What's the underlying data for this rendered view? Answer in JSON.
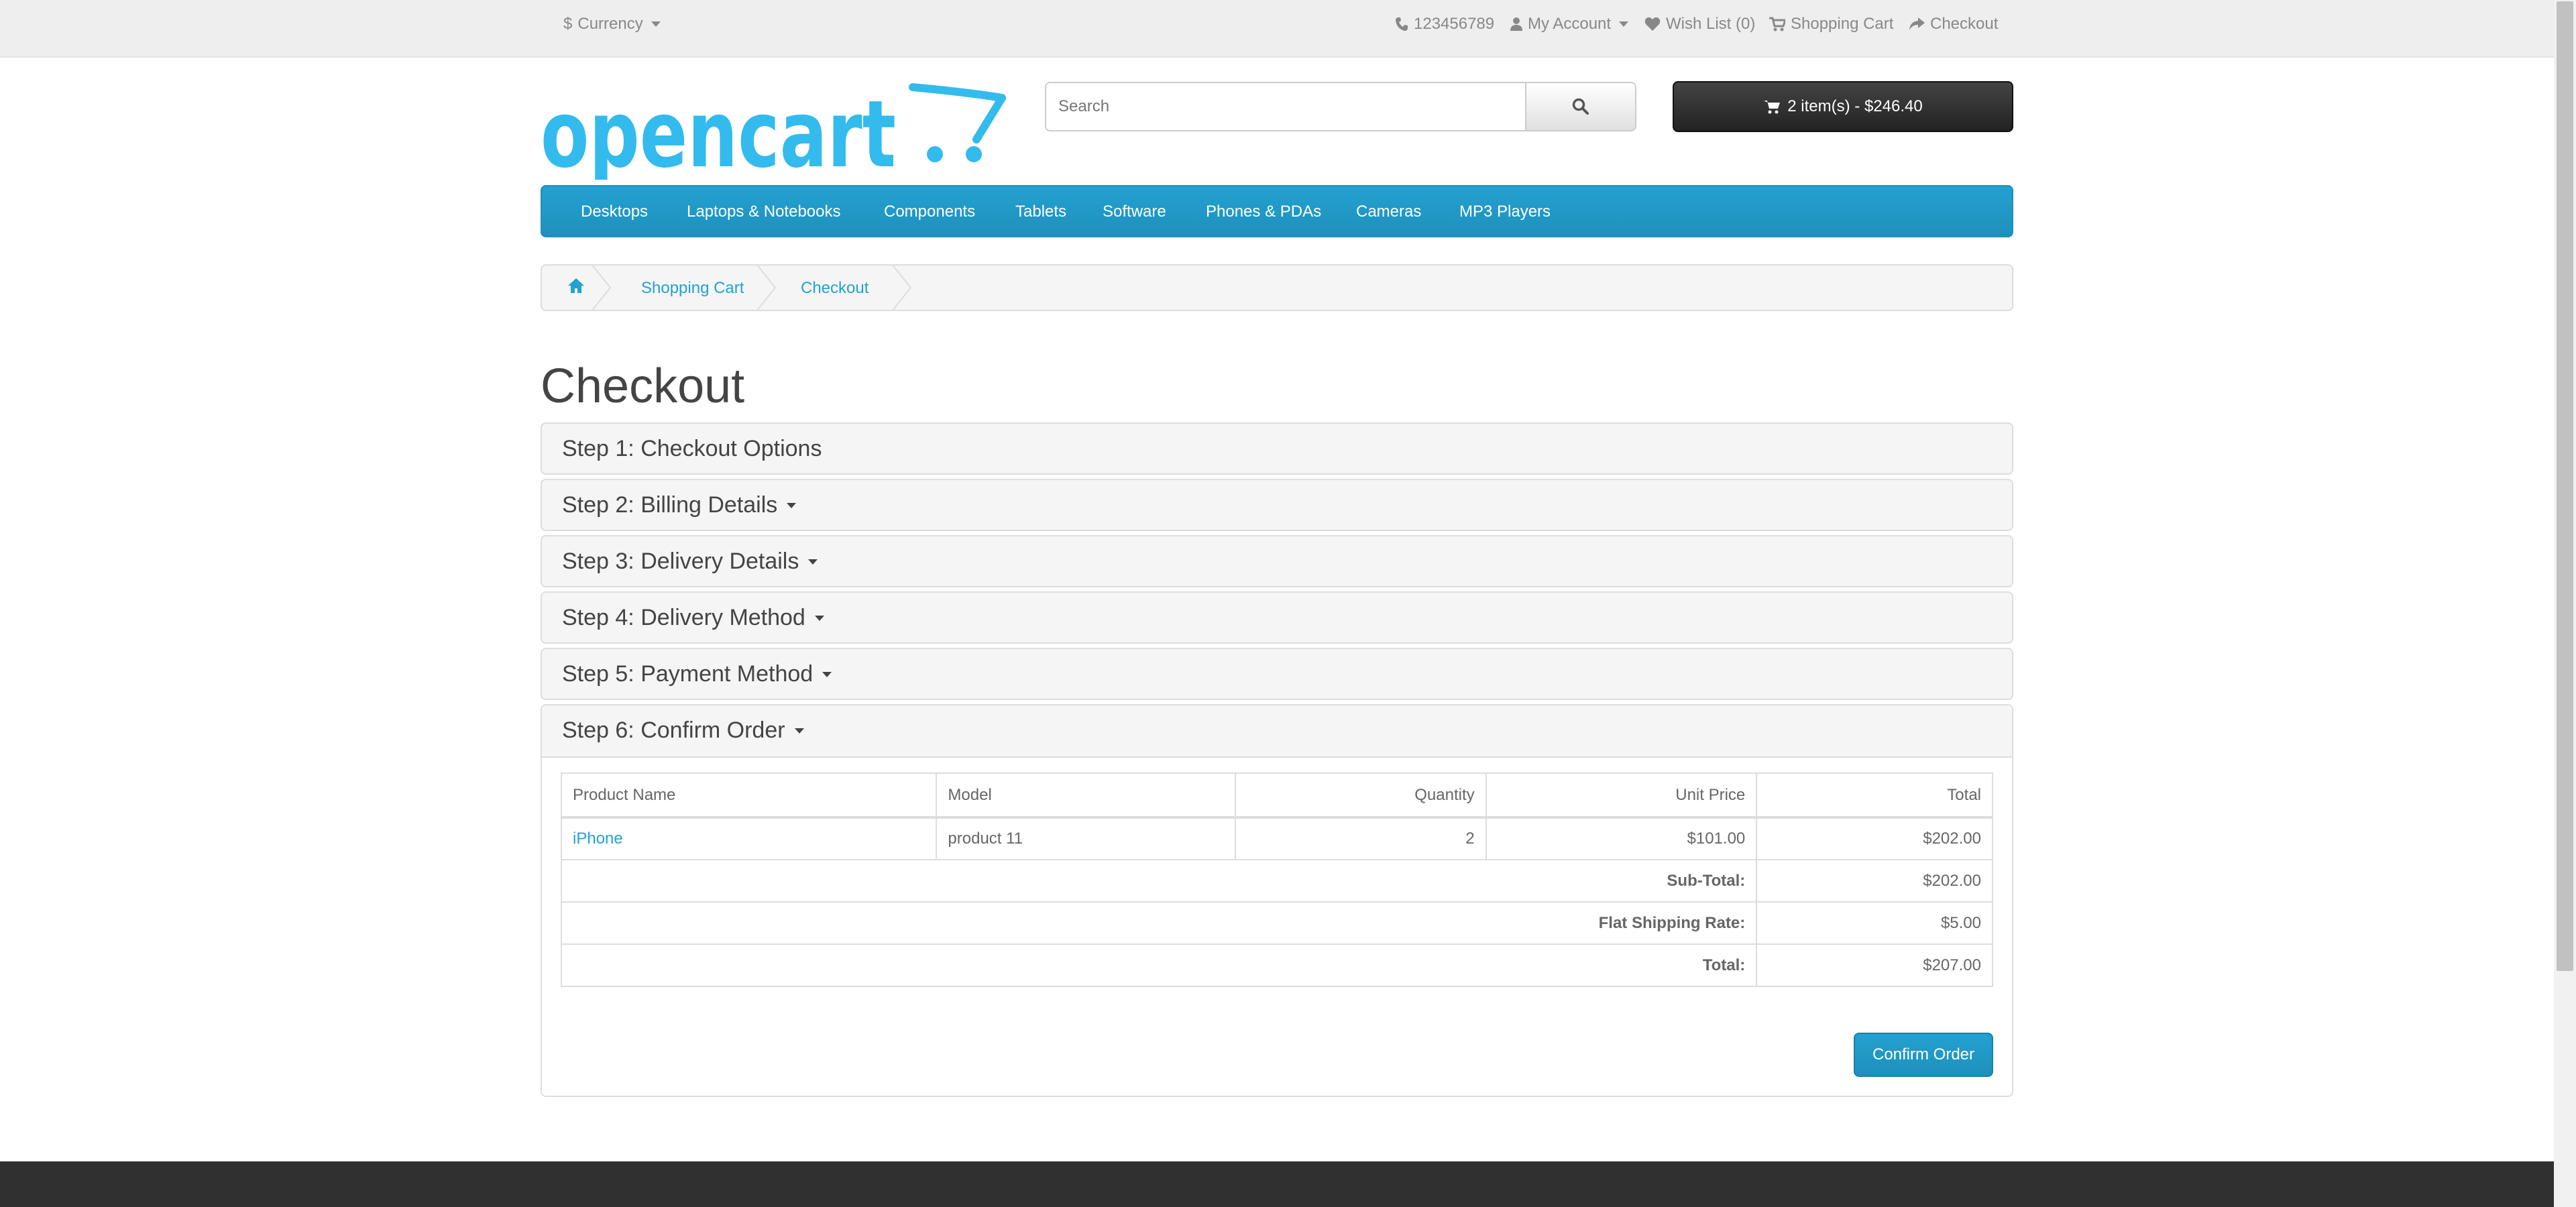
{
  "topbar": {
    "currency": "Currency",
    "currency_symbol": "$",
    "phone": "123456789",
    "my_account": "My Account",
    "wishlist": "Wish List (0)",
    "shopping_cart": "Shopping Cart",
    "checkout": "Checkout"
  },
  "header": {
    "logo_text": "opencart",
    "search_placeholder": "Search",
    "cart_summary": "2 item(s) - $246.40"
  },
  "menu": {
    "items": [
      "Desktops",
      "Laptops & Notebooks",
      "Components",
      "Tablets",
      "Software",
      "Phones & PDAs",
      "Cameras",
      "MP3 Players"
    ]
  },
  "breadcrumb": {
    "items": [
      "Shopping Cart",
      "Checkout"
    ]
  },
  "page": {
    "title": "Checkout"
  },
  "steps": [
    {
      "label": "Step 1: Checkout Options"
    },
    {
      "label": "Step 2: Billing Details"
    },
    {
      "label": "Step 3: Delivery Details"
    },
    {
      "label": "Step 4: Delivery Method"
    },
    {
      "label": "Step 5: Payment Method"
    },
    {
      "label": "Step 6: Confirm Order"
    }
  ],
  "order": {
    "headers": [
      "Product Name",
      "Model",
      "Quantity",
      "Unit Price",
      "Total"
    ],
    "rows": [
      {
        "name": "iPhone",
        "model": "product 11",
        "quantity": "2",
        "unit_price": "$101.00",
        "total": "$202.00"
      }
    ],
    "totals": [
      {
        "label": "Sub-Total:",
        "value": "$202.00"
      },
      {
        "label": "Flat Shipping Rate:",
        "value": "$5.00"
      },
      {
        "label": "Total:",
        "value": "$207.00"
      }
    ],
    "confirm_label": "Confirm Order"
  },
  "colors": {
    "accent": "#23a1d1",
    "dark_button": "#303030",
    "panel_bg": "#f5f5f5"
  }
}
